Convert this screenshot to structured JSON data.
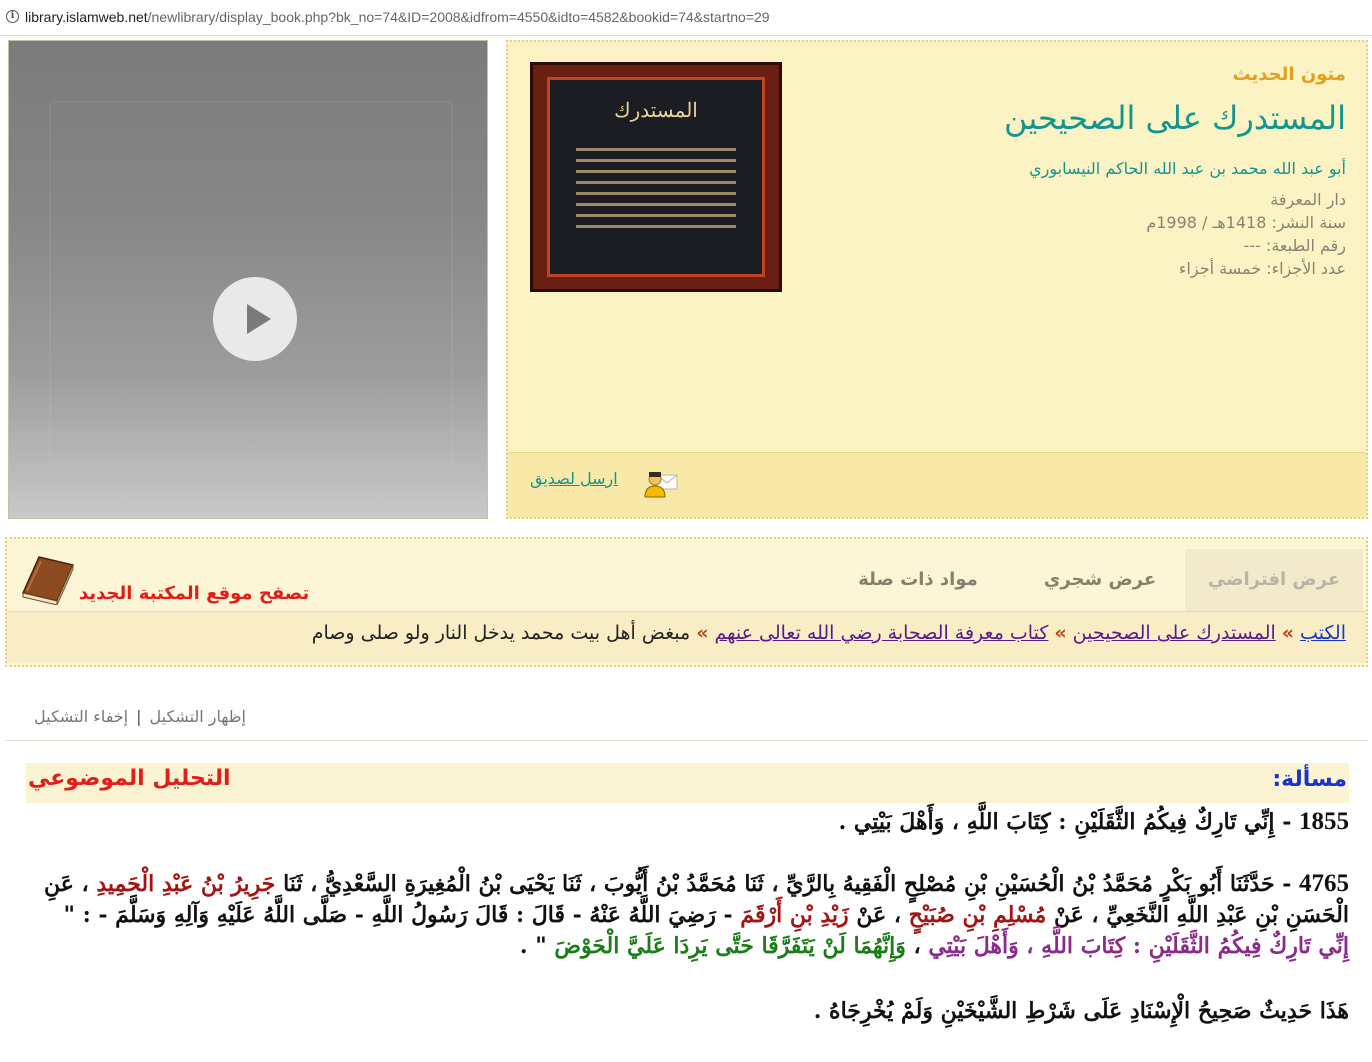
{
  "browser": {
    "url_host": "library.islamweb.net",
    "url_path": "/newlibrary/display_book.php?bk_no=74&ID=2008&idfrom=4550&idto=4582&bookid=74&startno=29"
  },
  "video": {
    "play_icon": "play-icon"
  },
  "book": {
    "category": "متون الحديث",
    "title": "المستدرك على الصحيحين",
    "author": "أبو عبد الله محمد بن عبد الله الحاكم النيسابوري",
    "publisher": "دار المعرفة",
    "publish_year": "سنة النشر: 1418هـ / 1998م",
    "edition": "رقم الطبعة: ---",
    "volumes": "عدد الأجزاء: خمسة أجزاء",
    "cover_title": "المستدرك",
    "send_to_friend": "ارسل لصديق"
  },
  "tabs": [
    "عرض افتراضي",
    "عرض شجري",
    "مواد ذات صلة"
  ],
  "new_site_link": "تصفح موقع المكتبة الجديد",
  "breadcrumb": {
    "items": [
      "الكتب",
      "المستدرك على الصحيحين",
      "كتاب معرفة الصحابة رضي الله تعالى عنهم"
    ],
    "current": "مبغض أهل بيت محمد يدخل النار ولو صلى وصام",
    "separator": "»"
  },
  "diacritics": {
    "show": "إظهار التشكيل",
    "hide": "إخفاء التشكيل",
    "separator": "|"
  },
  "question": {
    "label": "مسألة:",
    "analysis": "التحليل الموضوعي"
  },
  "hadith1": {
    "number": "1855",
    "text": " - إِنِّي تَارِكٌ فِيكُمُ الثَّقَلَيْنِ : كِتَابَ اللَّهِ ، وَأَهْلَ بَيْتِي ."
  },
  "hadith2": {
    "number": "4765",
    "p1": " - حَدَّثَنَا أَبُو بَكْرٍ مُحَمَّدُ بْنُ الْحُسَيْنِ بْنِ مُصْلِحٍ الْفَقِيهُ بِالرَّيِّ ، ثَنَا مُحَمَّدُ بْنُ أَيُّوبَ ، ثَنَا يَحْيَى بْنُ الْمُغِيرَةِ السَّعْدِيُّ ، ثَنَا ",
    "n1": "جَرِيرُ بْنُ عَبْدِ الْحَمِيدِ",
    "p2": " ، عَنِ الْحَسَنِ بْنِ عَبْدِ اللَّهِ النَّخَعِيِّ ، عَنْ ",
    "n2": "مُسْلِمِ بْنِ صُبَيْحٍ",
    "p3": " ، عَنْ ",
    "n3": "زَيْدِ بْنِ أَرْقَمَ",
    "p4": " - رَضِيَ اللَّهُ عَنْهُ - قَالَ : قَالَ رَسُولُ اللَّهِ - صَلَّى اللَّهُ عَلَيْهِ وَآلِهِ وَسَلَّمَ - : \" ",
    "quote1": "إِنِّي تَارِكٌ فِيكُمُ الثَّقَلَيْنِ : كِتَابَ اللَّهِ ، وَأَهْلَ بَيْتِي",
    "p5": " ، ",
    "quote2": "وَإِنَّهُمَا لَنْ يَتَفَرَّقَا حَتَّى يَرِدَا عَلَيَّ الْحَوْضَ",
    "p6": " \" ."
  },
  "hadith3": {
    "text": "هَذَا حَدِيثٌ صَحِيحُ الْإِسْنَادِ عَلَى شَرْطِ الشَّيْخَيْنِ وَلَمْ يُخْرِجَاهُ ."
  },
  "colors": {
    "teal": "#13958f",
    "gold": "#e0a020",
    "red": "#e31c1c",
    "narrator": "#a31515",
    "quote": "#8a2b8a",
    "quote2": "#1a7d1a"
  }
}
